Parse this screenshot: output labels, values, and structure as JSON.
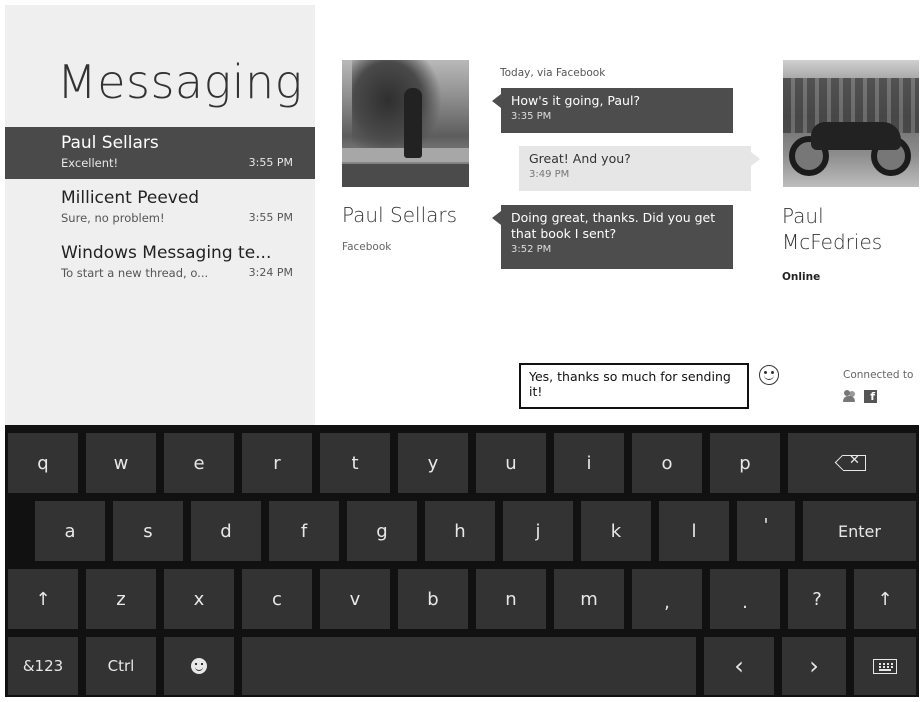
{
  "app": {
    "title": "Messaging"
  },
  "threads": [
    {
      "name": "Paul Sellars",
      "preview": "Excellent!",
      "time": "3:55 PM",
      "selected": true
    },
    {
      "name": "Millicent Peeved",
      "preview": "Sure, no problem!",
      "time": "3:55 PM",
      "selected": false
    },
    {
      "name": "Windows Messaging te...",
      "preview": "To start a new thread, o...",
      "time": "3:24 PM",
      "selected": false
    }
  ],
  "contact": {
    "name": "Paul Sellars",
    "network": "Facebook"
  },
  "conversation": {
    "header": "Today, via Facebook",
    "messages": [
      {
        "text": "How's it going, Paul?",
        "time": "3:35 PM",
        "direction": "in"
      },
      {
        "text": "Great! And you?",
        "time": "3:49 PM",
        "direction": "out"
      },
      {
        "text": "Doing great, thanks. Did you get that book I sent?",
        "time": "3:52 PM",
        "direction": "in"
      }
    ]
  },
  "me": {
    "name_line1": "Paul",
    "name_line2": "McFedries",
    "status": "Online"
  },
  "compose": {
    "value": "Yes, thanks so much for sending it!"
  },
  "connected": {
    "label": "Connected to",
    "icons": [
      "people-icon",
      "facebook-icon"
    ],
    "facebook_glyph": "f"
  },
  "keyboard": {
    "row1": [
      "q",
      "w",
      "e",
      "r",
      "t",
      "y",
      "u",
      "i",
      "o",
      "p"
    ],
    "row2": [
      "a",
      "s",
      "d",
      "f",
      "g",
      "h",
      "j",
      "k",
      "l",
      "'"
    ],
    "row3": [
      "z",
      "x",
      "c",
      "v",
      "b",
      "n",
      "m",
      ",",
      "."
    ],
    "enter": "Enter",
    "question": "?",
    "shift": "↑",
    "symbols": "&123",
    "ctrl": "Ctrl",
    "left": "‹",
    "right": "›",
    "backspace_glyph": "✕"
  },
  "colors": {
    "selected_thread": "#4a4a4a",
    "incoming_bubble": "#4d4d4d",
    "outgoing_bubble": "#e6e6e6",
    "keyboard_bg": "#111111",
    "key_bg": "#333333"
  }
}
